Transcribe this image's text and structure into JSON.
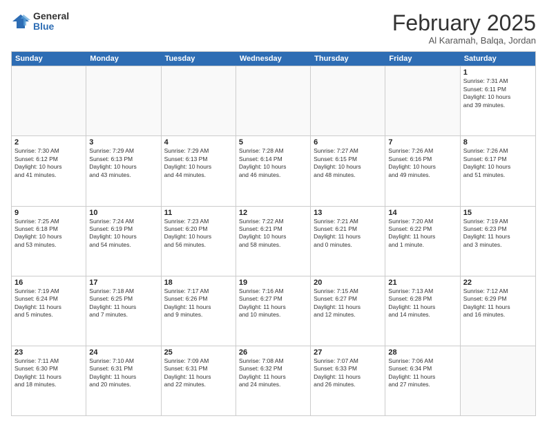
{
  "logo": {
    "general": "General",
    "blue": "Blue"
  },
  "header": {
    "month": "February 2025",
    "location": "Al Karamah, Balqa, Jordan"
  },
  "weekdays": [
    "Sunday",
    "Monday",
    "Tuesday",
    "Wednesday",
    "Thursday",
    "Friday",
    "Saturday"
  ],
  "rows": [
    [
      {
        "day": "",
        "info": ""
      },
      {
        "day": "",
        "info": ""
      },
      {
        "day": "",
        "info": ""
      },
      {
        "day": "",
        "info": ""
      },
      {
        "day": "",
        "info": ""
      },
      {
        "day": "",
        "info": ""
      },
      {
        "day": "1",
        "info": "Sunrise: 7:31 AM\nSunset: 6:11 PM\nDaylight: 10 hours\nand 39 minutes."
      }
    ],
    [
      {
        "day": "2",
        "info": "Sunrise: 7:30 AM\nSunset: 6:12 PM\nDaylight: 10 hours\nand 41 minutes."
      },
      {
        "day": "3",
        "info": "Sunrise: 7:29 AM\nSunset: 6:13 PM\nDaylight: 10 hours\nand 43 minutes."
      },
      {
        "day": "4",
        "info": "Sunrise: 7:29 AM\nSunset: 6:13 PM\nDaylight: 10 hours\nand 44 minutes."
      },
      {
        "day": "5",
        "info": "Sunrise: 7:28 AM\nSunset: 6:14 PM\nDaylight: 10 hours\nand 46 minutes."
      },
      {
        "day": "6",
        "info": "Sunrise: 7:27 AM\nSunset: 6:15 PM\nDaylight: 10 hours\nand 48 minutes."
      },
      {
        "day": "7",
        "info": "Sunrise: 7:26 AM\nSunset: 6:16 PM\nDaylight: 10 hours\nand 49 minutes."
      },
      {
        "day": "8",
        "info": "Sunrise: 7:26 AM\nSunset: 6:17 PM\nDaylight: 10 hours\nand 51 minutes."
      }
    ],
    [
      {
        "day": "9",
        "info": "Sunrise: 7:25 AM\nSunset: 6:18 PM\nDaylight: 10 hours\nand 53 minutes."
      },
      {
        "day": "10",
        "info": "Sunrise: 7:24 AM\nSunset: 6:19 PM\nDaylight: 10 hours\nand 54 minutes."
      },
      {
        "day": "11",
        "info": "Sunrise: 7:23 AM\nSunset: 6:20 PM\nDaylight: 10 hours\nand 56 minutes."
      },
      {
        "day": "12",
        "info": "Sunrise: 7:22 AM\nSunset: 6:21 PM\nDaylight: 10 hours\nand 58 minutes."
      },
      {
        "day": "13",
        "info": "Sunrise: 7:21 AM\nSunset: 6:21 PM\nDaylight: 11 hours\nand 0 minutes."
      },
      {
        "day": "14",
        "info": "Sunrise: 7:20 AM\nSunset: 6:22 PM\nDaylight: 11 hours\nand 1 minute."
      },
      {
        "day": "15",
        "info": "Sunrise: 7:19 AM\nSunset: 6:23 PM\nDaylight: 11 hours\nand 3 minutes."
      }
    ],
    [
      {
        "day": "16",
        "info": "Sunrise: 7:19 AM\nSunset: 6:24 PM\nDaylight: 11 hours\nand 5 minutes."
      },
      {
        "day": "17",
        "info": "Sunrise: 7:18 AM\nSunset: 6:25 PM\nDaylight: 11 hours\nand 7 minutes."
      },
      {
        "day": "18",
        "info": "Sunrise: 7:17 AM\nSunset: 6:26 PM\nDaylight: 11 hours\nand 9 minutes."
      },
      {
        "day": "19",
        "info": "Sunrise: 7:16 AM\nSunset: 6:27 PM\nDaylight: 11 hours\nand 10 minutes."
      },
      {
        "day": "20",
        "info": "Sunrise: 7:15 AM\nSunset: 6:27 PM\nDaylight: 11 hours\nand 12 minutes."
      },
      {
        "day": "21",
        "info": "Sunrise: 7:13 AM\nSunset: 6:28 PM\nDaylight: 11 hours\nand 14 minutes."
      },
      {
        "day": "22",
        "info": "Sunrise: 7:12 AM\nSunset: 6:29 PM\nDaylight: 11 hours\nand 16 minutes."
      }
    ],
    [
      {
        "day": "23",
        "info": "Sunrise: 7:11 AM\nSunset: 6:30 PM\nDaylight: 11 hours\nand 18 minutes."
      },
      {
        "day": "24",
        "info": "Sunrise: 7:10 AM\nSunset: 6:31 PM\nDaylight: 11 hours\nand 20 minutes."
      },
      {
        "day": "25",
        "info": "Sunrise: 7:09 AM\nSunset: 6:31 PM\nDaylight: 11 hours\nand 22 minutes."
      },
      {
        "day": "26",
        "info": "Sunrise: 7:08 AM\nSunset: 6:32 PM\nDaylight: 11 hours\nand 24 minutes."
      },
      {
        "day": "27",
        "info": "Sunrise: 7:07 AM\nSunset: 6:33 PM\nDaylight: 11 hours\nand 26 minutes."
      },
      {
        "day": "28",
        "info": "Sunrise: 7:06 AM\nSunset: 6:34 PM\nDaylight: 11 hours\nand 27 minutes."
      },
      {
        "day": "",
        "info": ""
      }
    ]
  ]
}
